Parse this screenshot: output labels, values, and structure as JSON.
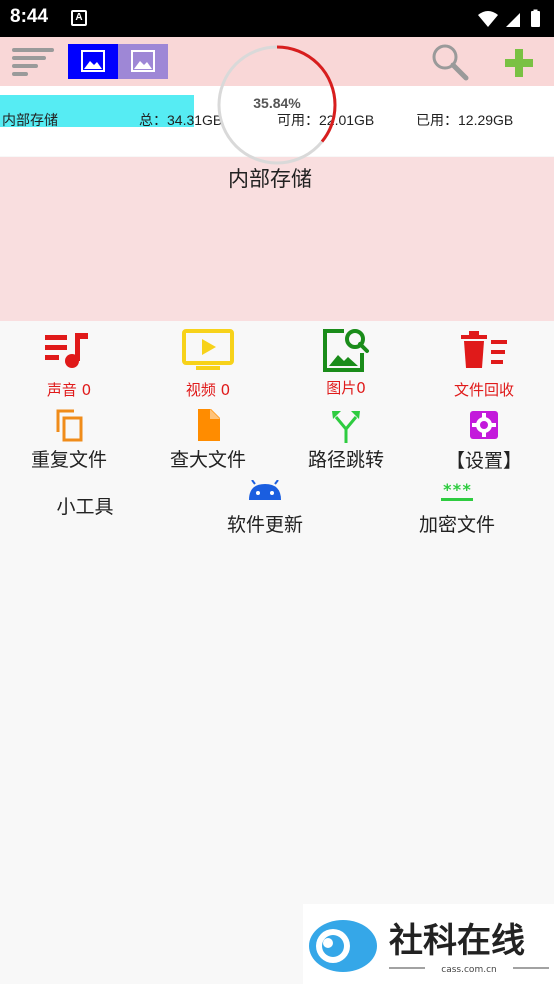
{
  "status_bar": {
    "time": "8:44",
    "notification_glyph": "A"
  },
  "toolbar": {
    "menu_icon": "sort-lines-icon",
    "view_icons": [
      "image-view-icon",
      "image-view-alt-icon"
    ],
    "search_icon": "search-icon",
    "add_icon": "plus-icon",
    "colors": {
      "background": "#f9d7d7",
      "view_active": "#0000ff",
      "view_alt": "#9e87d6",
      "add": "#7ac143"
    }
  },
  "storage": {
    "name": "内部存储",
    "total": "总：34.31GB",
    "available": "可用：22.01GB",
    "used": "已用：12.29GB",
    "bar_color": "#56ecf3"
  },
  "usage": {
    "title": "内部存储",
    "percent_label": "35.84%",
    "percent_value": 35.84,
    "ring_color": "#d81e1e"
  },
  "categories": [
    {
      "label": "声音 0",
      "icon": "music-list-icon",
      "color": "#e01a1a"
    },
    {
      "label": "视频 0",
      "icon": "video-play-icon",
      "color": "#f7d21a"
    },
    {
      "label": "图片0",
      "icon": "image-search-icon",
      "color": "#1a8c1a"
    },
    {
      "label": "文件回收",
      "icon": "trash-list-icon",
      "color": "#e01a1a"
    }
  ],
  "tools": [
    {
      "label": "重复文件",
      "icon": "copy-icon",
      "color": "#f08c1a"
    },
    {
      "label": "查大文件",
      "icon": "file-icon",
      "color": "#ff8c00"
    },
    {
      "label": "路径跳转",
      "icon": "merge-arrows-icon",
      "color": "#2ecc40"
    },
    {
      "label": "【设置】",
      "icon": "settings-icon",
      "color": "#c31adb"
    }
  ],
  "extras": {
    "small_tools": "小工具",
    "update": {
      "label": "软件更新",
      "icon": "android-icon",
      "color": "#1a5ee0"
    },
    "encrypt": {
      "label": "加密文件",
      "icon": "password-icon",
      "color": "#2ecc40"
    }
  },
  "watermark": {
    "brand": "社科在线",
    "url": "cass.com.cn"
  }
}
